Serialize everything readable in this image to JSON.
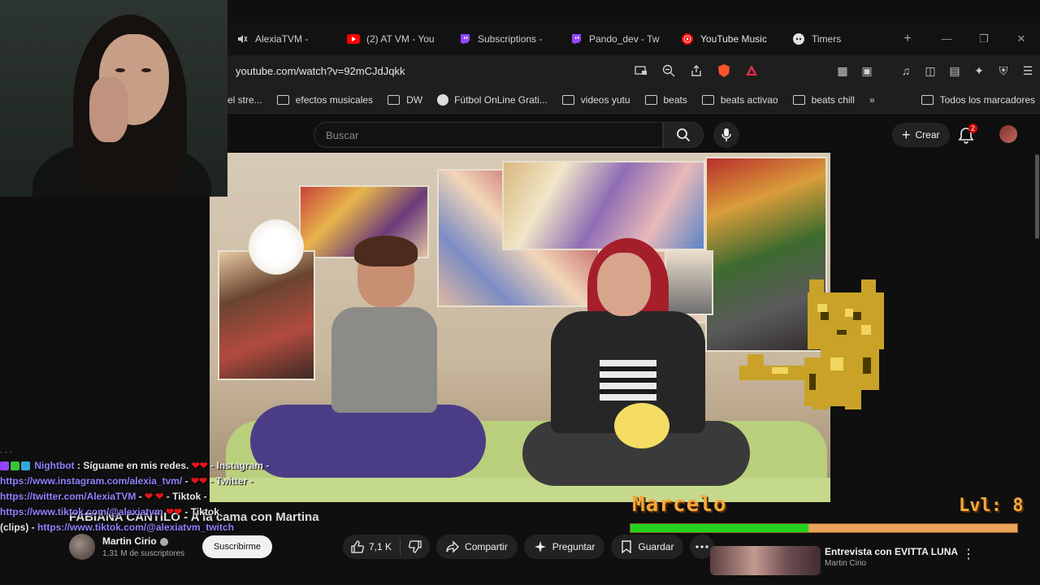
{
  "browser": {
    "tabs": [
      {
        "label": "AlexiaTVM -",
        "icon": "muted-speaker-icon"
      },
      {
        "label": "(2) AT VM - You",
        "icon": "youtube-icon"
      },
      {
        "label": "Subscriptions -",
        "icon": "twitch-icon"
      },
      {
        "label": "Pando_dev - Tw",
        "icon": "twitch-icon"
      },
      {
        "label": "YouTube Music",
        "icon": "youtube-music-icon"
      },
      {
        "label": "Timers",
        "icon": "discord-icon"
      }
    ],
    "new_tab": "+",
    "url": "youtube.com/watch?v=92mCJdJqkk",
    "bookmarks": [
      {
        "label": "el stre..."
      },
      {
        "label": "efectos musicales"
      },
      {
        "label": "DW"
      },
      {
        "label": "Fútbol OnLine Grati..."
      },
      {
        "label": "videos yutu"
      },
      {
        "label": "beats"
      },
      {
        "label": "beats activao"
      },
      {
        "label": "beats chill"
      }
    ],
    "bookmarks_more": "»",
    "all_bookmarks": "Todos los marcadores"
  },
  "youtube": {
    "search_placeholder": "Buscar",
    "create_label": "Crear",
    "notification_count": "2",
    "video_title": "FABIANA CANTILO - A la cama con Martina",
    "channel": {
      "name": "Martin Cirio",
      "subscribers": "1,31 M de suscriptores",
      "subscribe_label": "Suscribirme"
    },
    "actions": {
      "likes": "7,1 K",
      "share": "Compartir",
      "ask": "Preguntar",
      "save": "Guardar"
    },
    "recommendation": {
      "title": "Entrevista con EVITTA LUNA",
      "channel": "Martin Cirio"
    }
  },
  "hud": {
    "name": "Marcelo",
    "level": "Lvl: 8",
    "xp_fraction": 0.46,
    "colors": {
      "fill": "#22d31e",
      "track": "#e7a35c",
      "text": "#f2a93b"
    }
  },
  "chat": {
    "faded_line": "· · ·",
    "bot_name": "Nightbot",
    "bot_message": ": Síguame en mis redes.",
    "instagram_label": "- Instagram -",
    "instagram_url": "https://www.instagram.com/alexia_tvm/",
    "twitter_label": "- Twitter -",
    "twitter_url": "https://twitter.com/AlexiaTVM",
    "tiktok_label": "- Tiktok -",
    "tiktok_url": "https://www.tiktok.com/@alexiatvm",
    "tiktok2_label": "- Tiktok",
    "clips_prefix": "(clips) -",
    "clips_url": "https://www.tiktok.com/@alexiatvm_twitch",
    "dash": "-"
  }
}
